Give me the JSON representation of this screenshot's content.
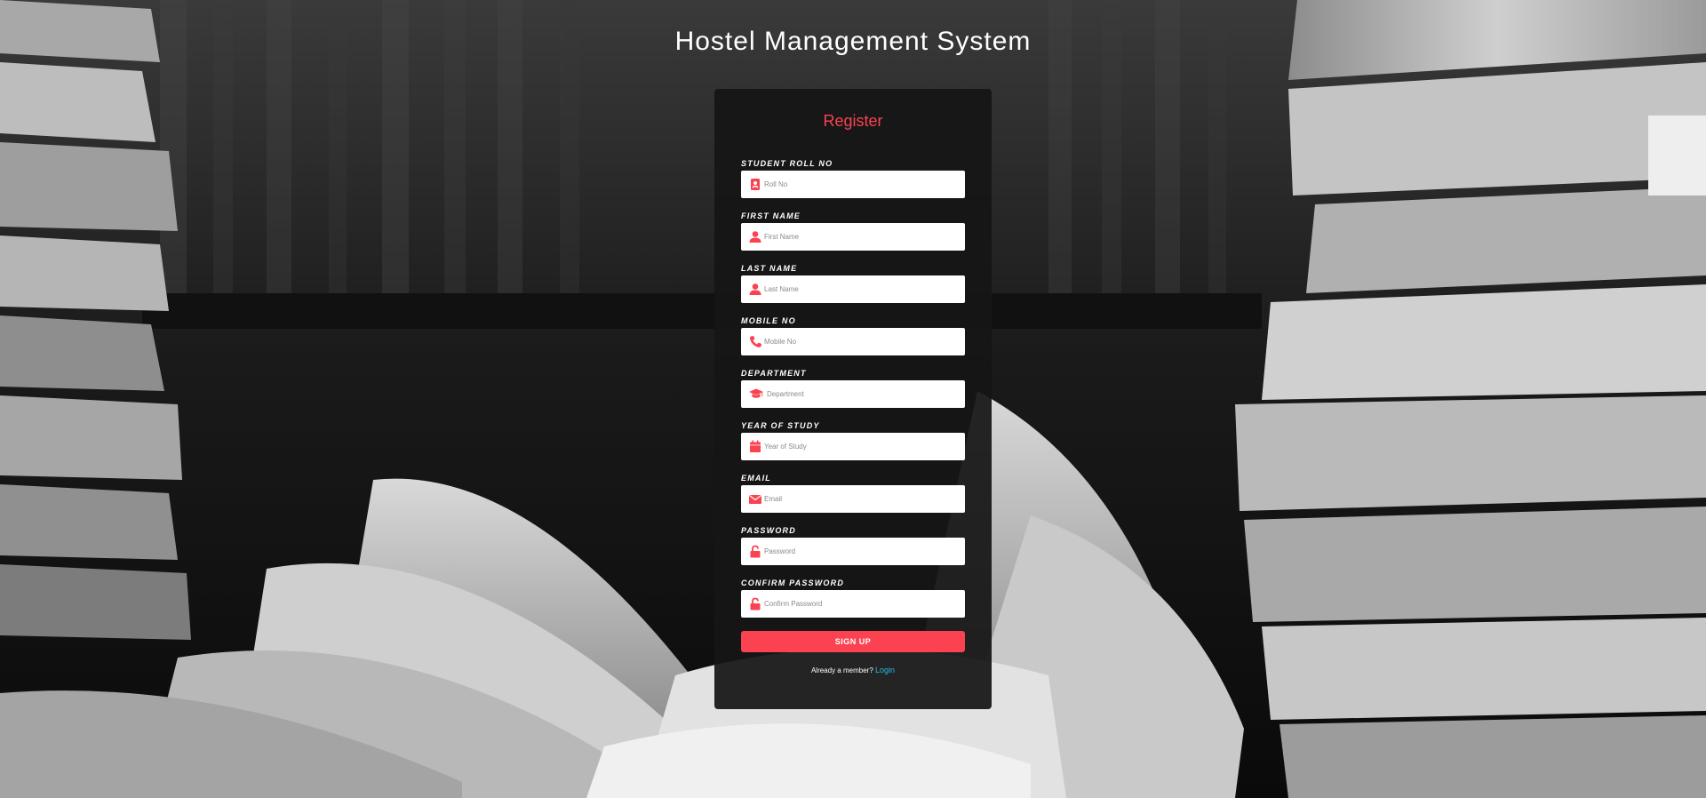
{
  "page": {
    "title": "Hostel Management System"
  },
  "form": {
    "heading": "Register",
    "fields": [
      {
        "label": "STUDENT ROLL NO",
        "placeholder": "Roll No",
        "icon": "id-card-icon"
      },
      {
        "label": "FIRST NAME",
        "placeholder": "First Name",
        "icon": "user-icon"
      },
      {
        "label": "LAST NAME",
        "placeholder": "Last Name",
        "icon": "user-icon"
      },
      {
        "label": "MOBILE NO",
        "placeholder": "Mobile No",
        "icon": "phone-icon"
      },
      {
        "label": "DEPARTMENT",
        "placeholder": "Department",
        "icon": "graduation-cap-icon"
      },
      {
        "label": "YEAR OF STUDY",
        "placeholder": "Year of Study",
        "icon": "calendar-icon"
      },
      {
        "label": "EMAIL",
        "placeholder": "Email",
        "icon": "envelope-icon"
      },
      {
        "label": "PASSWORD",
        "placeholder": "Password",
        "icon": "unlock-icon"
      },
      {
        "label": "CONFIRM PASSWORD",
        "placeholder": "Confirm Password",
        "icon": "unlock-icon"
      }
    ],
    "submit_label": "SIGN UP",
    "member_text": "Already a member?",
    "login_link": "Login"
  },
  "colors": {
    "accent": "#fa4251",
    "link": "#29b9e6",
    "card_bg": "#161616"
  }
}
